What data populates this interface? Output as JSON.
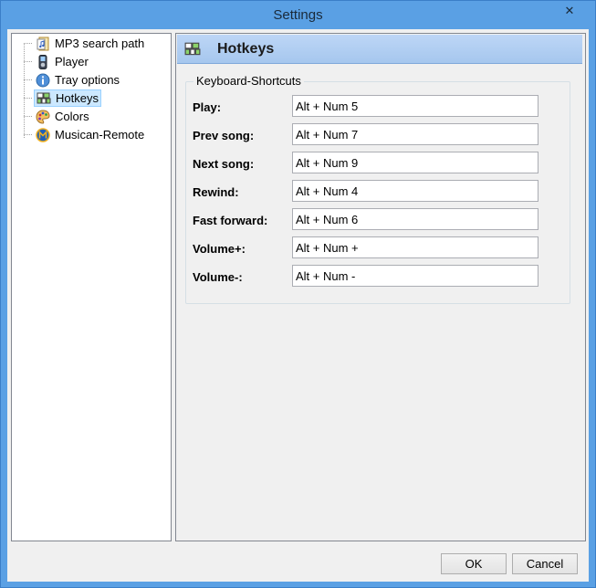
{
  "window": {
    "title": "Settings"
  },
  "tree": {
    "items": [
      {
        "label": "MP3 search path",
        "icon": "folder-music-icon"
      },
      {
        "label": "Player",
        "icon": "mp3-player-icon"
      },
      {
        "label": "Tray options",
        "icon": "info-icon"
      },
      {
        "label": "Hotkeys",
        "icon": "hotkeys-icon",
        "selected": true
      },
      {
        "label": "Colors",
        "icon": "palette-icon"
      },
      {
        "label": "Musican-Remote",
        "icon": "remote-icon"
      }
    ]
  },
  "panel": {
    "title": "Hotkeys",
    "group_title": "Keyboard-Shortcuts",
    "rows": [
      {
        "label": "Play:",
        "value": "Alt + Num 5"
      },
      {
        "label": "Prev song:",
        "value": "Alt + Num 7"
      },
      {
        "label": "Next song:",
        "value": "Alt + Num 9"
      },
      {
        "label": "Rewind:",
        "value": "Alt + Num 4"
      },
      {
        "label": "Fast forward:",
        "value": "Alt + Num 6"
      },
      {
        "label": "Volume+:",
        "value": "Alt + Num +"
      },
      {
        "label": "Volume-:",
        "value": "Alt + Num -"
      }
    ]
  },
  "buttons": {
    "ok": "OK",
    "cancel": "Cancel"
  },
  "colors": {
    "titlebar": "#5aa0e4",
    "selected": "#cce8ff",
    "header": "#bdd6f6"
  }
}
